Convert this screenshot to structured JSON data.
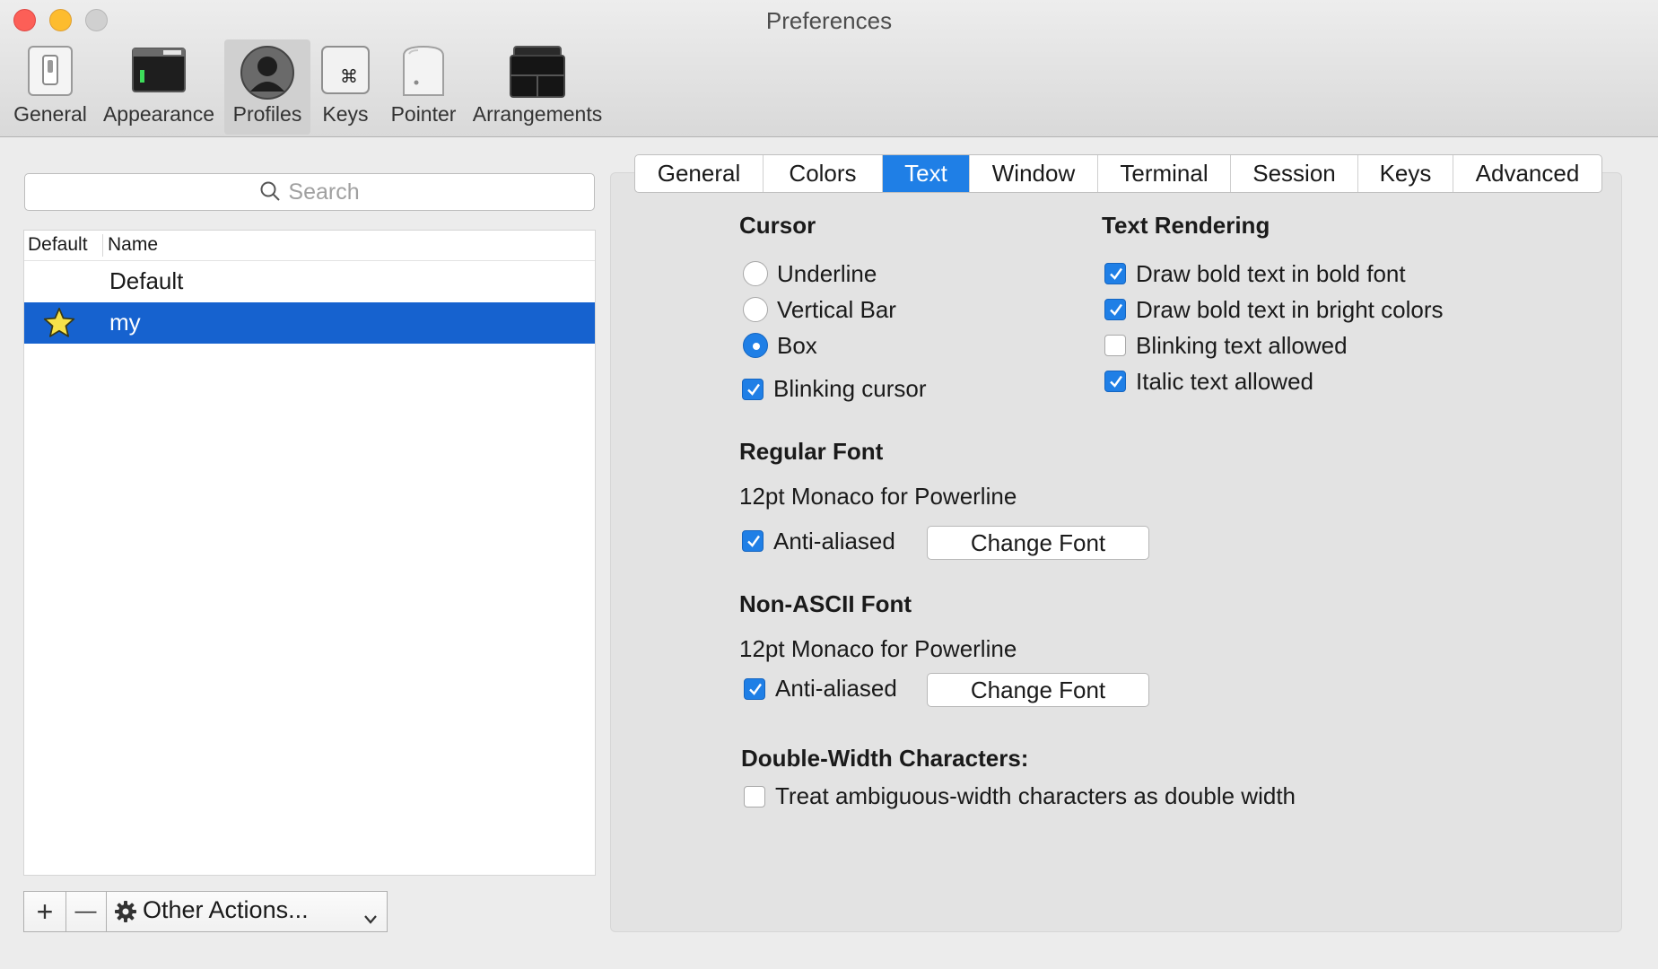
{
  "window": {
    "title": "Preferences"
  },
  "toolbar": {
    "items": [
      {
        "label": "General",
        "icon": "general-switch-icon"
      },
      {
        "label": "Appearance",
        "icon": "appearance-window-icon"
      },
      {
        "label": "Profiles",
        "icon": "profile-person-icon",
        "selected": true
      },
      {
        "label": "Keys",
        "icon": "command-key-icon"
      },
      {
        "label": "Pointer",
        "icon": "mouse-icon"
      },
      {
        "label": "Arrangements",
        "icon": "arrangements-windows-icon"
      }
    ]
  },
  "profiles": {
    "search_placeholder": "Search",
    "columns": {
      "default": "Default",
      "name": "Name"
    },
    "rows": [
      {
        "name": "Default",
        "is_default": false,
        "selected": false
      },
      {
        "name": "my",
        "is_default": true,
        "selected": true
      }
    ],
    "add_label": "+",
    "remove_label": "—",
    "other_actions_label": "Other Actions..."
  },
  "tabs": [
    {
      "label": "General"
    },
    {
      "label": "Colors"
    },
    {
      "label": "Text",
      "selected": true
    },
    {
      "label": "Window"
    },
    {
      "label": "Terminal"
    },
    {
      "label": "Session"
    },
    {
      "label": "Keys"
    },
    {
      "label": "Advanced"
    }
  ],
  "cursor": {
    "heading": "Cursor",
    "options": [
      {
        "label": "Underline",
        "checked": false
      },
      {
        "label": "Vertical Bar",
        "checked": false
      },
      {
        "label": "Box",
        "checked": true
      }
    ],
    "blinking": {
      "label": "Blinking cursor",
      "checked": true
    }
  },
  "text_rendering": {
    "heading": "Text Rendering",
    "options": [
      {
        "label": "Draw bold text in bold font",
        "checked": true
      },
      {
        "label": "Draw bold text in bright colors",
        "checked": true
      },
      {
        "label": "Blinking text allowed",
        "checked": false
      },
      {
        "label": "Italic text allowed",
        "checked": true
      }
    ]
  },
  "regular_font": {
    "heading": "Regular Font",
    "value": "12pt Monaco for Powerline",
    "anti_aliased": {
      "label": "Anti-aliased",
      "checked": true
    },
    "button": "Change Font"
  },
  "non_ascii_font": {
    "heading": "Non-ASCII Font",
    "value": "12pt Monaco for Powerline",
    "anti_aliased": {
      "label": "Anti-aliased",
      "checked": true
    },
    "button": "Change Font"
  },
  "double_width": {
    "heading": "Double-Width Characters:",
    "option": {
      "label": "Treat ambiguous-width characters as double width",
      "checked": false
    }
  },
  "colors": {
    "accent": "#1f7fe6",
    "selection": "#1662cf"
  }
}
